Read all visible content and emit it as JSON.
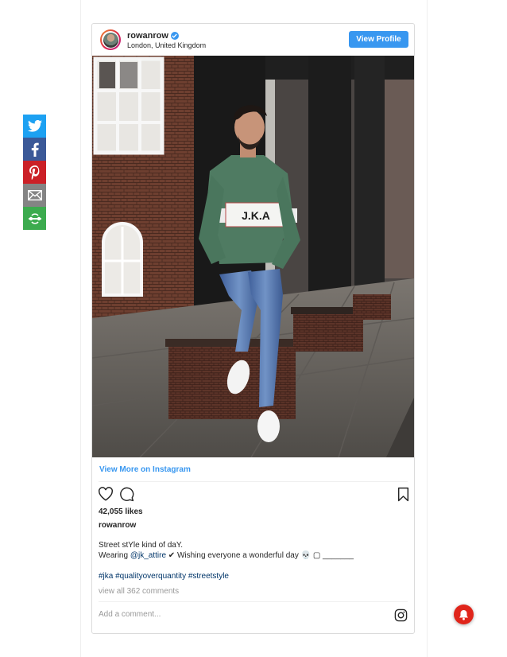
{
  "share": {
    "items": [
      {
        "name": "twitter-icon",
        "color": "#1da1f2"
      },
      {
        "name": "facebook-icon",
        "color": "#3b5998"
      },
      {
        "name": "pinterest-icon",
        "color": "#cb2027"
      },
      {
        "name": "email-icon",
        "color": "#848484"
      },
      {
        "name": "more-icon",
        "color": "#3cab4e"
      }
    ]
  },
  "post": {
    "username": "rowanrow",
    "location": "London, United Kingdom",
    "view_profile_label": "View Profile",
    "view_more_label": "View More on Instagram",
    "likes": "42,055 likes",
    "caption_user": "rowanrow",
    "caption_line1": "Street stYle kind of daY.",
    "caption_line2_prefix": "Wearing ",
    "caption_mention": "@jk_attire",
    "caption_line2_suffix": " ✔ Wishing everyone a wonderful day 💀 ▢ _______",
    "hashtags": "#jka #qualityoverquantity #streetstyle",
    "comments_link": "view all 362 comments",
    "comment_placeholder": "Add a comment...",
    "sweater_text": "J.K.A"
  },
  "colors": {
    "accent": "#3897f0",
    "link": "#003569",
    "notification": "#e0251b"
  }
}
